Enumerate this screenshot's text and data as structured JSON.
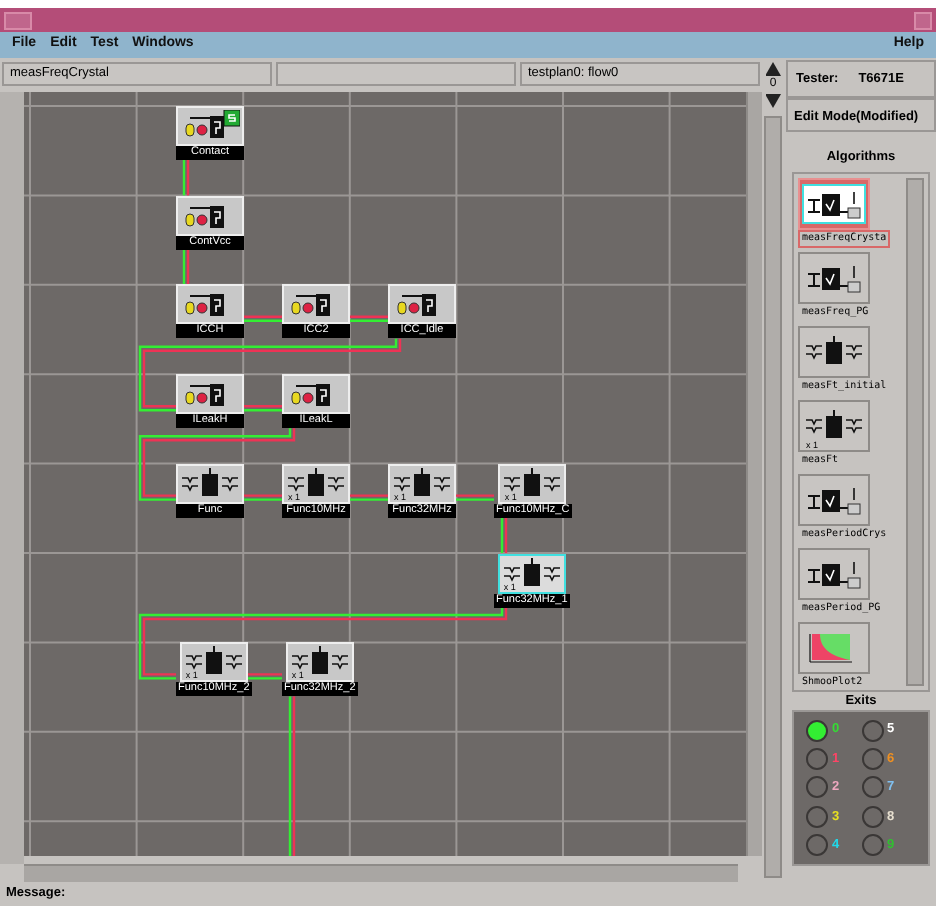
{
  "menu": {
    "items": [
      "File",
      "Edit",
      "Test",
      "Windows"
    ],
    "help": "Help"
  },
  "info_bar": {
    "algorithm": "measFreqCrystal",
    "flow": "testplan0: flow0"
  },
  "spinner": {
    "value": "0"
  },
  "flow": {
    "nodes": [
      {
        "label": "Contact",
        "kind": "contact",
        "selected": false
      },
      {
        "label": "ContVcc",
        "kind": "dc",
        "selected": false
      },
      {
        "label": "ICCH",
        "kind": "dc",
        "selected": false
      },
      {
        "label": "ICC2",
        "kind": "dc",
        "selected": false
      },
      {
        "label": "ICC_Idle",
        "kind": "dc",
        "selected": false
      },
      {
        "label": "ILeakH",
        "kind": "dc",
        "selected": false
      },
      {
        "label": "ILeakL",
        "kind": "dc",
        "selected": false
      },
      {
        "label": "Func",
        "kind": "func",
        "selected": false
      },
      {
        "label": "Func10MHz",
        "kind": "func",
        "badge": "x 1",
        "selected": false
      },
      {
        "label": "Func32MHz",
        "kind": "func",
        "badge": "x 1",
        "selected": false
      },
      {
        "label": "Func10MHz_C",
        "kind": "func",
        "badge": "x 1",
        "selected": false
      },
      {
        "label": "Func32MHz_1",
        "kind": "func",
        "badge": "x 1",
        "selected": true
      },
      {
        "label": "Func10MHz_2",
        "kind": "func",
        "badge": "x 1",
        "selected": false
      },
      {
        "label": "Func32MHz_2",
        "kind": "func",
        "badge": "x 1",
        "selected": false,
        "continues": true
      }
    ]
  },
  "panel": {
    "tester_label": "Tester:",
    "tester": "T6671E",
    "mode": "Edit Mode(Modified)",
    "algorithms_title": "Algorithms",
    "algorithms": [
      {
        "label": "measFreqCrysta",
        "kind": "freq",
        "selected": true
      },
      {
        "label": "measFreq_PG",
        "kind": "freq",
        "selected": false
      },
      {
        "label": "measFt_initial",
        "kind": "ft",
        "selected": false
      },
      {
        "label": "measFt",
        "kind": "ft",
        "badge": "x 1",
        "selected": false
      },
      {
        "label": "measPeriodCrys",
        "kind": "period",
        "selected": false
      },
      {
        "label": "measPeriod_PG",
        "kind": "period",
        "selected": false
      },
      {
        "label": "ShmooPlot2",
        "kind": "shmoo",
        "selected": false
      }
    ],
    "exits_title": "Exits",
    "exits": [
      {
        "label": "0",
        "color": "#33dd33",
        "lit": true
      },
      {
        "label": "1",
        "color": "#ff4466",
        "lit": false
      },
      {
        "label": "2",
        "color": "#f0a8c0",
        "lit": false
      },
      {
        "label": "3",
        "color": "#e8e020",
        "lit": false
      },
      {
        "label": "4",
        "color": "#20d8e8",
        "lit": false
      },
      {
        "label": "5",
        "color": "#ffffff",
        "lit": false
      },
      {
        "label": "6",
        "color": "#f09020",
        "lit": false
      },
      {
        "label": "7",
        "color": "#80c0f0",
        "lit": false
      },
      {
        "label": "8",
        "color": "#e8e0d0",
        "lit": false
      },
      {
        "label": "9",
        "color": "#30c030",
        "lit": false
      }
    ]
  },
  "status_bar": {
    "label": "Message:"
  }
}
